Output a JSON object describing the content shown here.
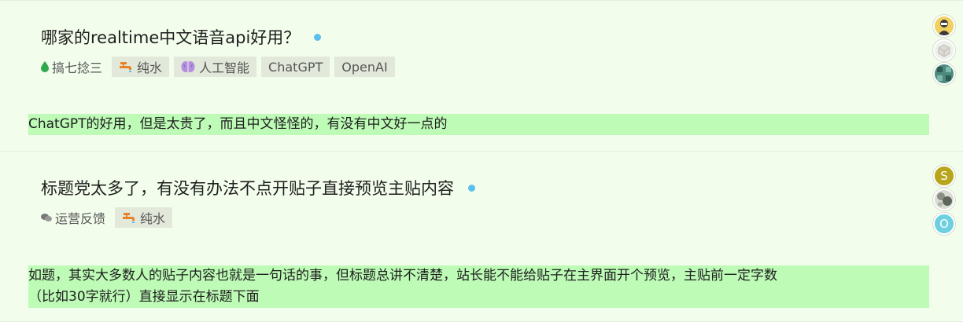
{
  "topics": [
    {
      "title": "哪家的realtime中文语音api好用？",
      "category": {
        "label": "搞七捻三",
        "icon": "droplet-icon",
        "color": "#2fa84f"
      },
      "tags": [
        {
          "label": "纯水",
          "icon": "faucet-icon"
        },
        {
          "label": "人工智能",
          "icon": "brain-icon"
        },
        {
          "label": "ChatGPT"
        },
        {
          "label": "OpenAI"
        }
      ],
      "avatars": [
        "avatar-1",
        "avatar-2",
        "avatar-3"
      ],
      "excerpt": "ChatGPT的好用，但是太贵了，而且中文怪怪的，有没有中文好一点的"
    },
    {
      "title": "标题党太多了，有没有办法不点开贴子直接预览主贴内容",
      "category": {
        "label": "运营反馈",
        "icon": "chat-bubbles-icon",
        "color": "#777777"
      },
      "tags": [
        {
          "label": "纯水",
          "icon": "faucet-icon"
        }
      ],
      "avatars": [
        "S",
        "avatar-5",
        "O"
      ],
      "excerpt_lines": [
        "如题，其实大多数人的贴子内容也就是一句话的事，但标题总讲不清楚，站长能不能给贴子在主界面开个预览，主贴前一定字数",
        "（比如30字就行）直接显示在标题下面"
      ]
    }
  ],
  "colors": {
    "background": "#f3fdec",
    "excerpt_highlight": "#bdfbb6",
    "tag_bg": "#e2e8da",
    "unread_dot": "#5bc0eb",
    "faucet_icon": "#e8822a",
    "brain_icon": "#b48ee0"
  }
}
